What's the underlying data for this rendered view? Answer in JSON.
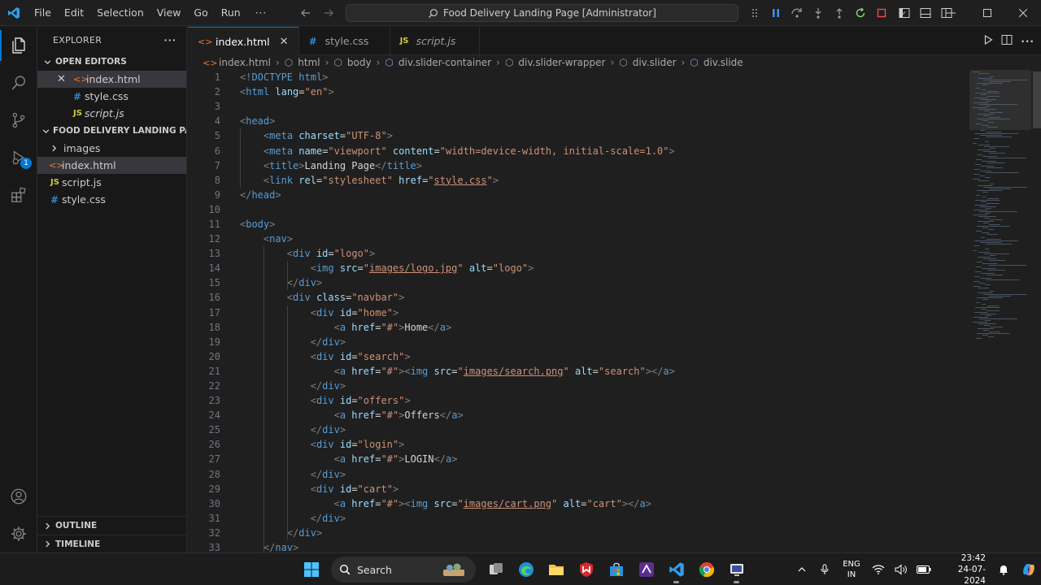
{
  "titlebar": {
    "menu": [
      "File",
      "Edit",
      "Selection",
      "View",
      "Go",
      "Run"
    ],
    "more": "···",
    "command_center": "Food Delivery Landing Page [Administrator]"
  },
  "sidebar": {
    "title": "EXPLORER",
    "more": "···",
    "open_editors": {
      "label": "OPEN EDITORS",
      "items": [
        {
          "name": "index.html",
          "type": "html"
        },
        {
          "name": "style.css",
          "type": "css"
        },
        {
          "name": "script.js",
          "type": "js"
        }
      ]
    },
    "project": {
      "label": "FOOD DELIVERY LANDING PAGE",
      "items": [
        {
          "name": "images",
          "type": "folder"
        },
        {
          "name": "index.html",
          "type": "html"
        },
        {
          "name": "script.js",
          "type": "js"
        },
        {
          "name": "style.css",
          "type": "css"
        }
      ]
    },
    "outline": "OUTLINE",
    "timeline": "TIMELINE"
  },
  "activity_badge": "1",
  "tabs": [
    {
      "label": "index.html",
      "type": "html",
      "active": true
    },
    {
      "label": "style.css",
      "type": "css",
      "active": false
    },
    {
      "label": "script.js",
      "type": "js",
      "active": false
    }
  ],
  "breadcrumbs": [
    "index.html",
    "html",
    "body",
    "div.slider-container",
    "div.slider-wrapper",
    "div.slider",
    "div.slide"
  ],
  "code_lines": [
    "<!DOCTYPE html>",
    "<html lang=\"en\">",
    "",
    "<head>",
    "    <meta charset=\"UTF-8\">",
    "    <meta name=\"viewport\" content=\"width=device-width, initial-scale=1.0\">",
    "    <title>Landing Page</title>",
    "    <link rel=\"stylesheet\" href=\"style.css\">",
    "</head>",
    "",
    "<body>",
    "    <nav>",
    "        <div id=\"logo\">",
    "            <img src=\"images/logo.jpg\" alt=\"logo\">",
    "        </div>",
    "        <div class=\"navbar\">",
    "            <div id=\"home\">",
    "                <a href=\"#\">Home</a>",
    "            </div>",
    "            <div id=\"search\">",
    "                <a href=\"#\"><img src=\"images/search.png\" alt=\"search\"></a>",
    "            </div>",
    "            <div id=\"offers\">",
    "                <a href=\"#\">Offers</a>",
    "            </div>",
    "            <div id=\"login\">",
    "                <a href=\"#\">LOGIN</a>",
    "            </div>",
    "            <div id=\"cart\">",
    "                <a href=\"#\"><img src=\"images/cart.png\" alt=\"cart\"></a>",
    "            </div>",
    "        </div>",
    "    </nav>"
  ],
  "taskbar": {
    "search": "Search",
    "lang_top": "ENG",
    "lang_bottom": "IN",
    "time": "23:42",
    "date": "24-07-2024"
  },
  "colors": {
    "accent": "#0078d4",
    "tag": "#569cd6",
    "attribute": "#9cdcfe",
    "string": "#ce9178"
  }
}
